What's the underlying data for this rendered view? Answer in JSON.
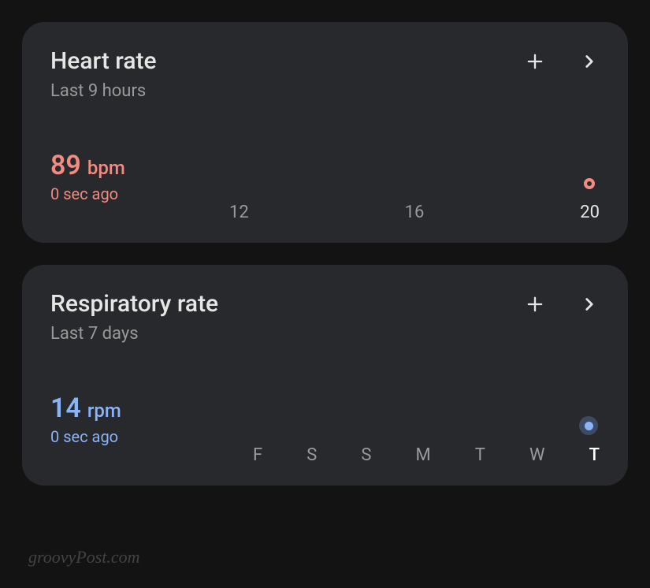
{
  "cards": {
    "heart": {
      "title": "Heart rate",
      "subtitle": "Last 9 hours",
      "value": "89",
      "unit": "bpm",
      "timestamp": "0 sec ago",
      "axis": [
        "12",
        "16",
        "20"
      ],
      "accent": "#f28b82"
    },
    "resp": {
      "title": "Respiratory rate",
      "subtitle": "Last 7 days",
      "value": "14",
      "unit": "rpm",
      "timestamp": "0 sec ago",
      "axis": [
        "F",
        "S",
        "S",
        "M",
        "T",
        "W",
        "T"
      ],
      "accent": "#8ab4f8"
    }
  },
  "watermark": "groovyPost.com"
}
